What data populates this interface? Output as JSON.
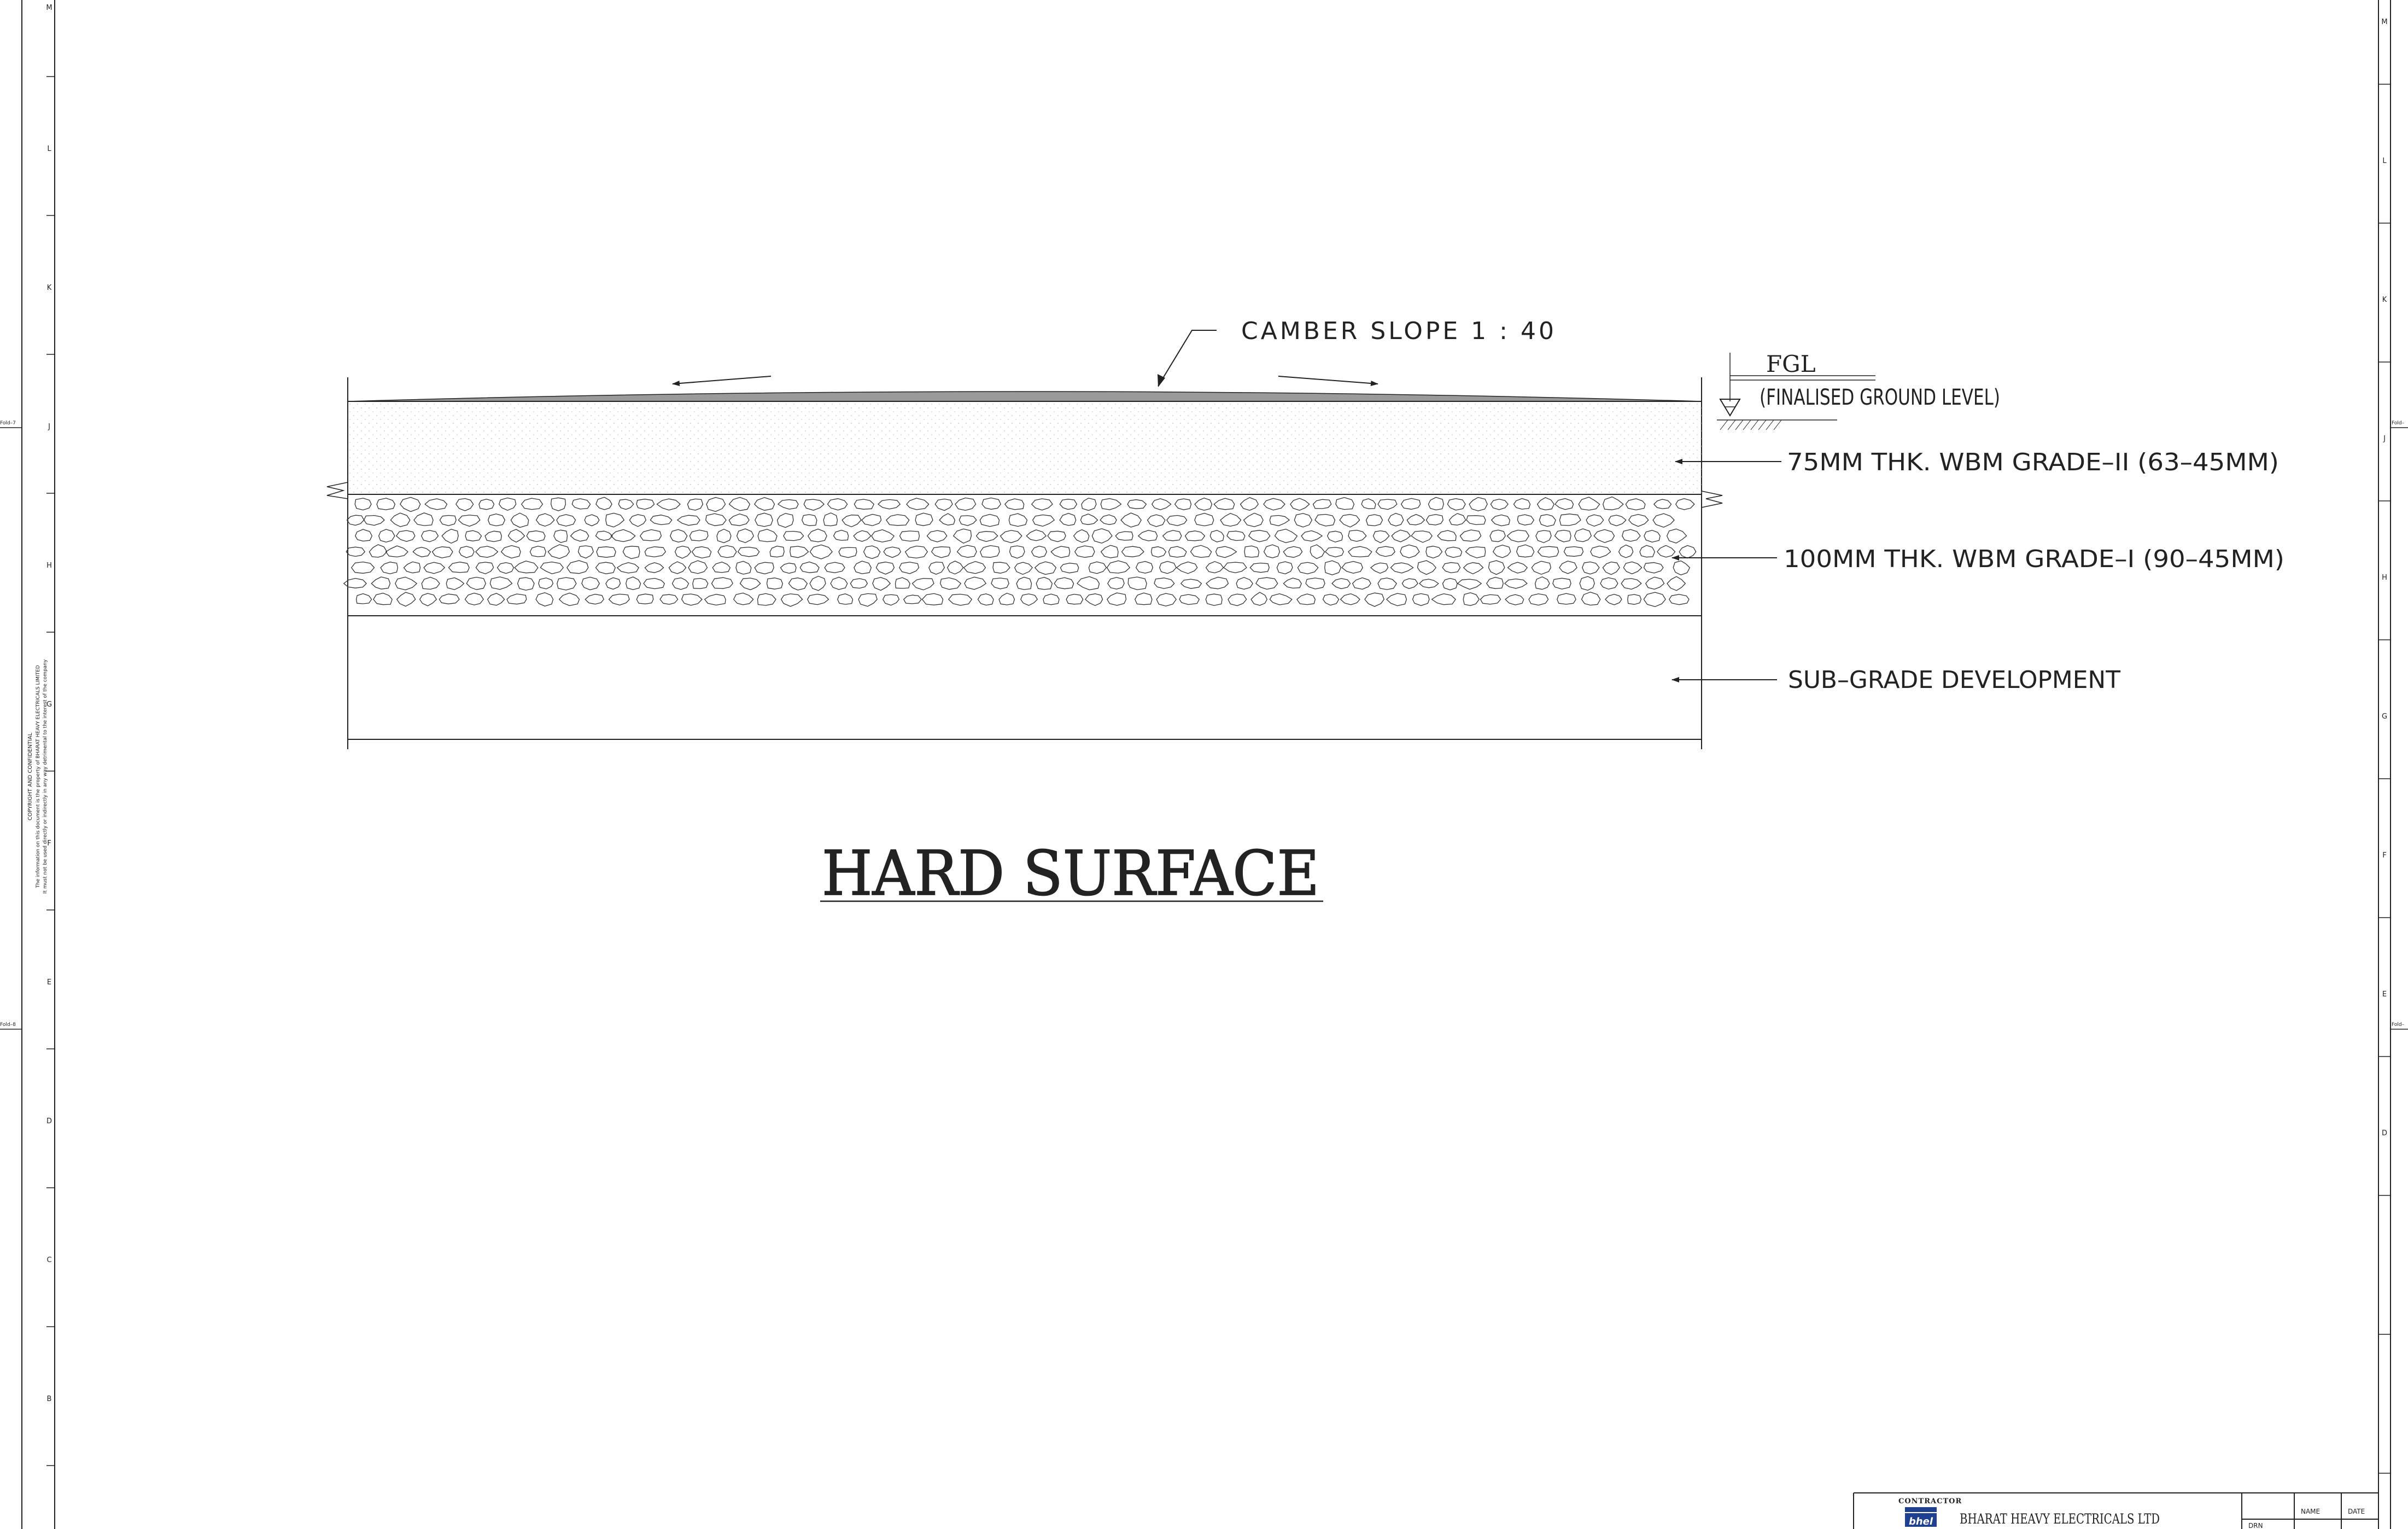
{
  "drawing": {
    "title": "HARD SURFACE",
    "camber_label": "CAMBER SLOPE 1 : 40",
    "fgl": {
      "label": "FGL",
      "description": "(FINALISED GROUND LEVEL)"
    },
    "layers": [
      {
        "label": "75MM THK. WBM GRADE–II (63–45MM)"
      },
      {
        "label": "100MM THK. WBM GRADE–I (90–45MM)"
      },
      {
        "label": "SUB–GRADE DEVELOPMENT"
      }
    ]
  },
  "border": {
    "left_zones": [
      "M",
      "L",
      "K",
      "J",
      "H",
      "G",
      "F",
      "E",
      "D",
      "C",
      "B"
    ],
    "right_zones": [
      "M",
      "L",
      "K",
      "J",
      "H",
      "G",
      "F",
      "E",
      "D"
    ],
    "fold_marks_left": [
      "Fold–7",
      "Fold–8"
    ],
    "fold_marks_right": [
      "Fold–",
      "Fold–"
    ],
    "copyright_lines": [
      "COPYRIGHT AND CONFIDENTIAL",
      "The information on this document is the property of BHARAT HEAVY ELECTRICALS LIMITED",
      "It must not be used directly or indirectly in any way detrimental to the interest of the company"
    ]
  },
  "title_block": {
    "contractor_label": "CONTRACTOR",
    "logo_text": "bhel",
    "company": "BHARAT HEAVY ELECTRICALS LTD",
    "col_name": "NAME",
    "col_date": "DATE",
    "row_drn": "DRN"
  },
  "colors": {
    "line": "#222222",
    "camber_fill": "#9a9a9a",
    "logo_blue": "#1f3f8f"
  }
}
